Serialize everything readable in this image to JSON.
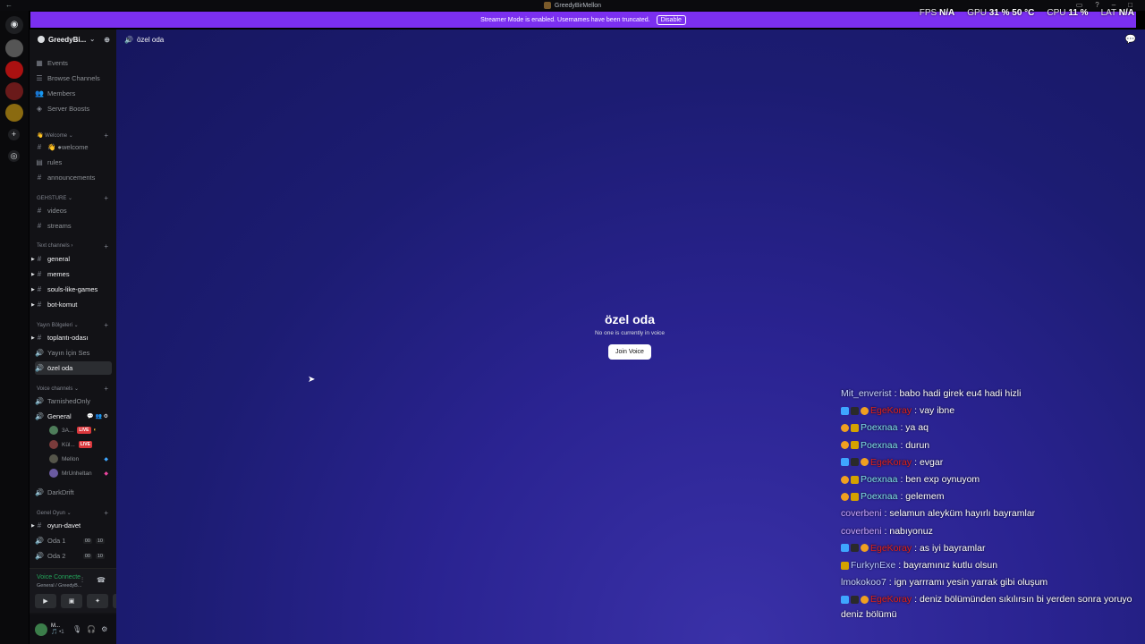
{
  "window": {
    "title": "GreedyBirMellon"
  },
  "banner": {
    "text": "Streamer Mode is enabled. Usernames have been truncated.",
    "disable_label": "Disable"
  },
  "perf": [
    {
      "label": "FPS",
      "value": "N/A"
    },
    {
      "label": "GPU",
      "value": "31 %  50 °C"
    },
    {
      "label": "CPU",
      "value": "11 %"
    },
    {
      "label": "LAT",
      "value": "N/A"
    }
  ],
  "server": {
    "name": "GreedyBi...",
    "chevron": "⌄"
  },
  "nav": [
    {
      "label": "Events",
      "icon": "calendar-icon"
    },
    {
      "label": "Browse Channels",
      "icon": "browse-icon"
    },
    {
      "label": "Members",
      "icon": "members-icon"
    },
    {
      "label": "Server Boosts",
      "icon": "boost-icon"
    }
  ],
  "categories": {
    "welcome": "👋 Welcome ⌄",
    "gehsture": "GEHSTURE ⌄",
    "text_channels": "Text channels ›",
    "yayin": "Yayın Bölgeleri ⌄",
    "voice_channels": "Voice channels ⌄",
    "genel_oyun": "Genel Oyun ⌄"
  },
  "channels": {
    "welcome": "👋 ●welcome",
    "rules": "rules",
    "announcements": "announcements",
    "videos": "videos",
    "streams": "streams",
    "general": "general",
    "memes": "memes",
    "souls": "souls-like-games",
    "bot": "bot-komut",
    "toplanti": "toplantı-odası",
    "yayin_sesi": "Yayın İçin Ses",
    "ozel": "özel oda",
    "tarnished": "TarnishedOnly",
    "general_voice": "General",
    "darkdrift": "DarkDrift",
    "oyun_davet": "oyun-davet",
    "oda1": "Oda 1",
    "oda2": "Oda 2"
  },
  "voice_users": [
    {
      "name": "3A...",
      "live": "LIVE",
      "color": "#4e7d5a"
    },
    {
      "name": "Kül...",
      "live": "LIVE",
      "color": "#7a3b3b"
    },
    {
      "name": "Mellon",
      "live": "",
      "color": "#55554a"
    },
    {
      "name": "MrUnheltan",
      "live": "",
      "color": "#6a5aa0"
    }
  ],
  "room_counts": {
    "oda1": [
      "00",
      "10"
    ],
    "oda2": [
      "00",
      "10"
    ]
  },
  "voice_status": {
    "title": "Voice Connecte",
    "sub": "General / GreedyB..."
  },
  "user": {
    "name": "M...",
    "status": "🎵 •1"
  },
  "main": {
    "channel": "özel oda",
    "title": "özel oda",
    "subtitle": "No one is currently in voice",
    "join_label": "Join Voice"
  },
  "chat": [
    {
      "badges": [],
      "name": "Mit_enverist",
      "color": "#c9d6ff",
      "text": ": babo hadi girek eu4 hadi hizli"
    },
    {
      "badges": [
        "b-blue",
        "b-dark",
        "b-orange"
      ],
      "name": "EgeKoray",
      "color": "#e0201a",
      "text": ": vay ibne"
    },
    {
      "badges": [
        "b-orange",
        "b-gold"
      ],
      "name": "Poexnaa",
      "color": "#7fe0e6",
      "text": ": ya aq"
    },
    {
      "badges": [
        "b-orange",
        "b-gold"
      ],
      "name": "Poexnaa",
      "color": "#7fe0e6",
      "text": ": durun"
    },
    {
      "badges": [
        "b-blue",
        "b-dark",
        "b-orange"
      ],
      "name": "EgeKoray",
      "color": "#e0201a",
      "text": ": evgar"
    },
    {
      "badges": [
        "b-orange",
        "b-gold"
      ],
      "name": "Poexnaa",
      "color": "#7fe0e6",
      "text": ": ben exp oynuyom"
    },
    {
      "badges": [
        "b-orange",
        "b-gold"
      ],
      "name": "Poexnaa",
      "color": "#7fe0e6",
      "text": ": gelemem"
    },
    {
      "badges": [],
      "name": "coverbeni",
      "color": "#c9a6ff",
      "text": ": selamun aleyküm hayırlı bayramlar"
    },
    {
      "badges": [],
      "name": "coverbeni",
      "color": "#c9a6ff",
      "text": ": nabıyonuz"
    },
    {
      "badges": [
        "b-blue",
        "b-dark",
        "b-orange"
      ],
      "name": "EgeKoray",
      "color": "#e0201a",
      "text": ": as iyi bayramlar"
    },
    {
      "badges": [
        "b-gold"
      ],
      "name": "FurkynExe",
      "color": "#b8c8ff",
      "text": ": bayramınız kutlu olsun"
    },
    {
      "badges": [],
      "name": "lmokokoo7",
      "color": "#c9d6ff",
      "text": ": ign yarrramı yesin yarrak gibi oluşum"
    },
    {
      "badges": [
        "b-blue",
        "b-dark",
        "b-orange"
      ],
      "name": "EgeKoray",
      "color": "#e0201a",
      "text": ": deniz bölümünden sıkılırsın bi yerden sonra yoruyo"
    }
  ],
  "chat_continuation": "deniz bölümü"
}
